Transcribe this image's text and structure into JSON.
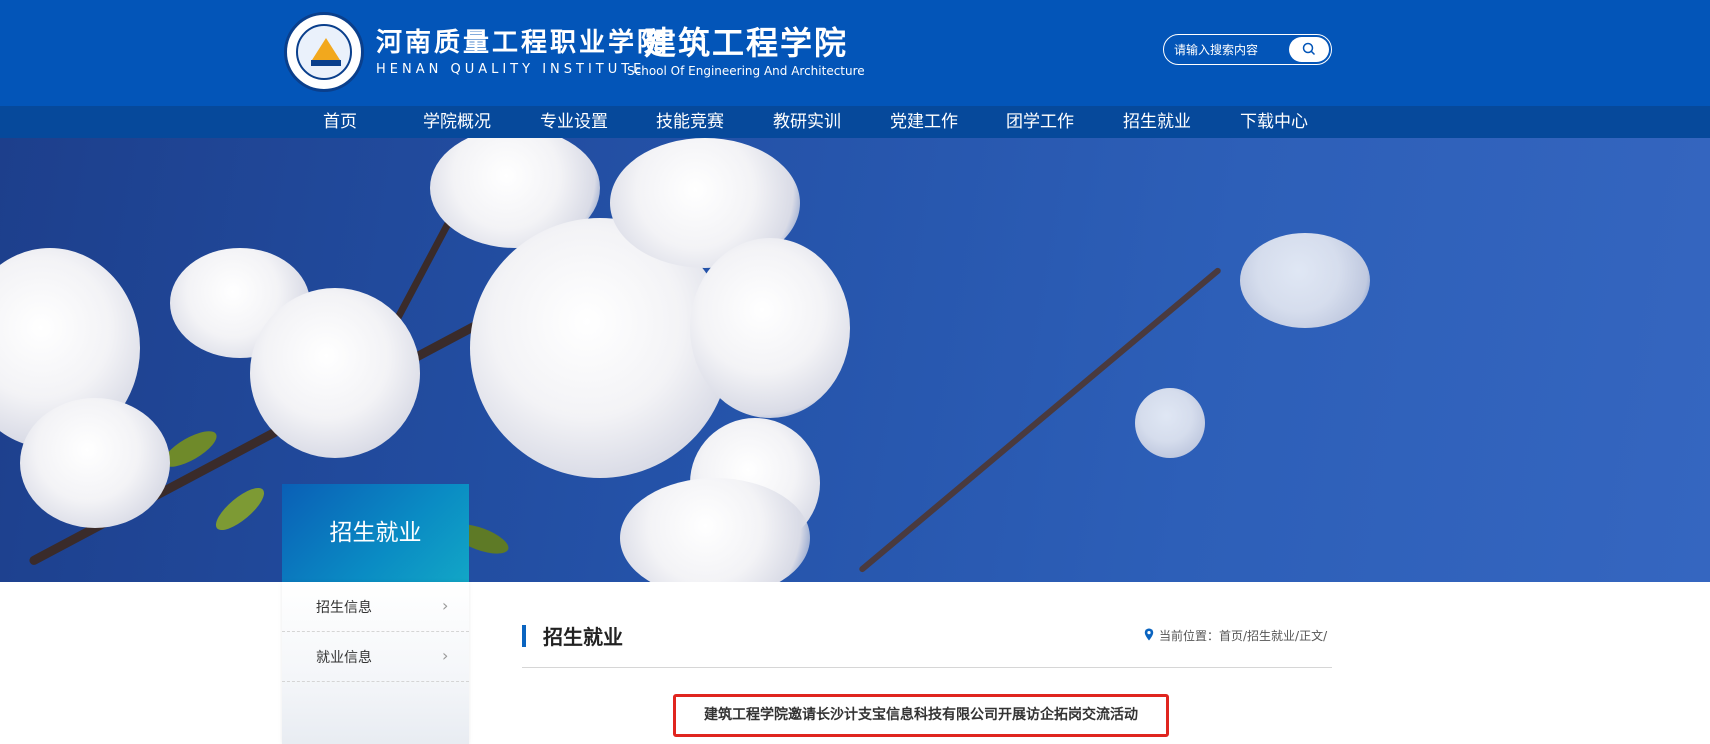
{
  "header": {
    "school_cn": "河南质量工程职业学院",
    "school_en": "HENAN QUALITY INSTITUTE",
    "college_cn": "建筑工程学院",
    "college_en": "School Of Engineering And Architecture",
    "logo_icon": "school-seal-icon"
  },
  "search": {
    "placeholder": "请输入搜索内容",
    "icon": "search-icon"
  },
  "nav": {
    "items": [
      {
        "label": "首页"
      },
      {
        "label": "学院概况"
      },
      {
        "label": "专业设置"
      },
      {
        "label": "技能竞赛"
      },
      {
        "label": "教研实训"
      },
      {
        "label": "党建工作"
      },
      {
        "label": "团学工作"
      },
      {
        "label": "招生就业"
      },
      {
        "label": "下载中心"
      }
    ]
  },
  "sidebar": {
    "title": "招生就业",
    "items": [
      {
        "label": "招生信息",
        "icon": "chevron-right-icon"
      },
      {
        "label": "就业信息",
        "icon": "chevron-right-icon"
      }
    ]
  },
  "content": {
    "section_title": "招生就业",
    "breadcrumb": "当前位置：首页/招生就业/正文/",
    "breadcrumb_icon": "location-pin-icon",
    "article_title": "建筑工程学院邀请长沙计支宝信息科技有限公司开展访企拓岗交流活动"
  },
  "colors": {
    "header_bg": "#0355b8",
    "nav_bg": "#06499b",
    "accent": "#0a64c0",
    "highlight_border": "#e0251f"
  }
}
